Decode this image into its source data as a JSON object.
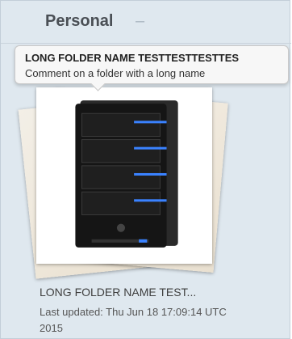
{
  "section": {
    "title": "Personal",
    "collapse_symbol": "–"
  },
  "tooltip": {
    "title": "LONG FOLDER NAME TESTTESTTESTTES",
    "comment": "Comment on a folder with a long name"
  },
  "folder": {
    "name": "LONG FOLDER NAME TEST...",
    "updated": "Last updated: Thu Jun 18 17:09:14 UTC 2015",
    "thumbnail_icon": "server-icon"
  },
  "colors": {
    "panel_bg": "#dfe8ef",
    "led_blue": "#3a82ff"
  }
}
